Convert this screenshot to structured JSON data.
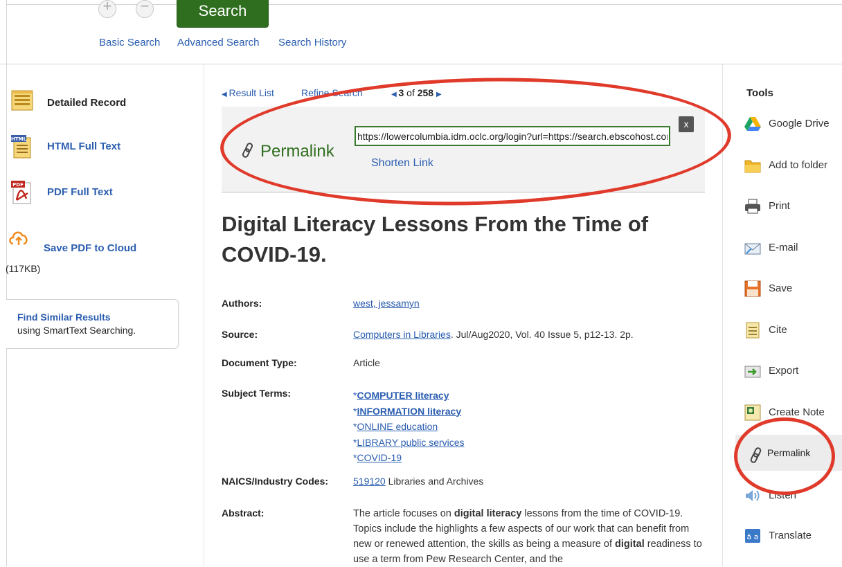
{
  "header": {
    "search_label": "Search",
    "nav": [
      "Basic Search",
      "Advanced Search",
      "Search History"
    ]
  },
  "left_nav": {
    "detailed_record": "Detailed Record",
    "html_full_text": "HTML Full Text",
    "pdf_full_text": "PDF Full Text",
    "save_pdf_cloud": "Save PDF to Cloud",
    "pdf_size": "(117KB)",
    "find_similar_title": "Find Similar Results",
    "find_similar_sub": "using SmartText Searching.",
    "html_badge": "HTML",
    "pdf_badge": "PDF"
  },
  "result_nav": {
    "result_list": "Result List",
    "refine_search": "Refine Search",
    "current": "3",
    "of_label": "of",
    "total": "258"
  },
  "permalink_panel": {
    "label": "Permalink",
    "url": "https://lowercolumbia.idm.oclc.org/login?url=https://search.ebscohost.com",
    "shorten_label": "Shorten Link",
    "close_label": "x"
  },
  "article": {
    "title": "Digital Literacy Lessons From the Time of COVID-19.",
    "labels": {
      "authors": "Authors:",
      "source": "Source:",
      "doc_type": "Document Type:",
      "subject_terms": "Subject Terms:",
      "naics": "NAICS/Industry Codes:",
      "abstract": "Abstract:"
    },
    "author": "west, jessamyn",
    "source_link": "Computers in Libraries",
    "source_rest": ". Jul/Aug2020, Vol. 40 Issue 5, p12-13. 2p.",
    "document_type": "Article",
    "subject_terms": [
      {
        "star": "*",
        "term": "COMPUTER literacy"
      },
      {
        "star": "*",
        "term": "INFORMATION literacy"
      },
      {
        "star": "*",
        "term": "ONLINE education"
      },
      {
        "star": "*",
        "term": "LIBRARY public services"
      },
      {
        "star": "*",
        "term": "COVID-19"
      }
    ],
    "naics_code": "519120",
    "naics_desc": " Libraries and Archives",
    "abstract": {
      "p1": "The article focuses on ",
      "b1": "digital literacy",
      "p2": " lessons from the time of COVID-19. Topics include the highlights a few aspects of our work that can benefit from new or renewed attention, the skills as being a measure of ",
      "b2": "digital",
      "p3": " readiness to use a term from Pew Research Center, and the"
    }
  },
  "tools": {
    "heading": "Tools",
    "items": [
      {
        "label": "Google Drive",
        "icon": "google-drive-icon"
      },
      {
        "label": "Add to folder",
        "icon": "folder-icon"
      },
      {
        "label": "Print",
        "icon": "printer-icon"
      },
      {
        "label": "E-mail",
        "icon": "email-icon"
      },
      {
        "label": "Save",
        "icon": "save-icon"
      },
      {
        "label": "Cite",
        "icon": "cite-icon"
      },
      {
        "label": "Export",
        "icon": "export-icon"
      },
      {
        "label": "Create Note",
        "icon": "note-icon"
      },
      {
        "label": "Permalink",
        "icon": "link-icon"
      },
      {
        "label": "Listen",
        "icon": "speaker-icon"
      },
      {
        "label": "Translate",
        "icon": "translate-icon"
      }
    ]
  },
  "colors": {
    "link": "#2a5db0",
    "search_button": "#2f6e1e",
    "permalink_label": "#2f6e1e",
    "annotation": "#e03a2b"
  }
}
